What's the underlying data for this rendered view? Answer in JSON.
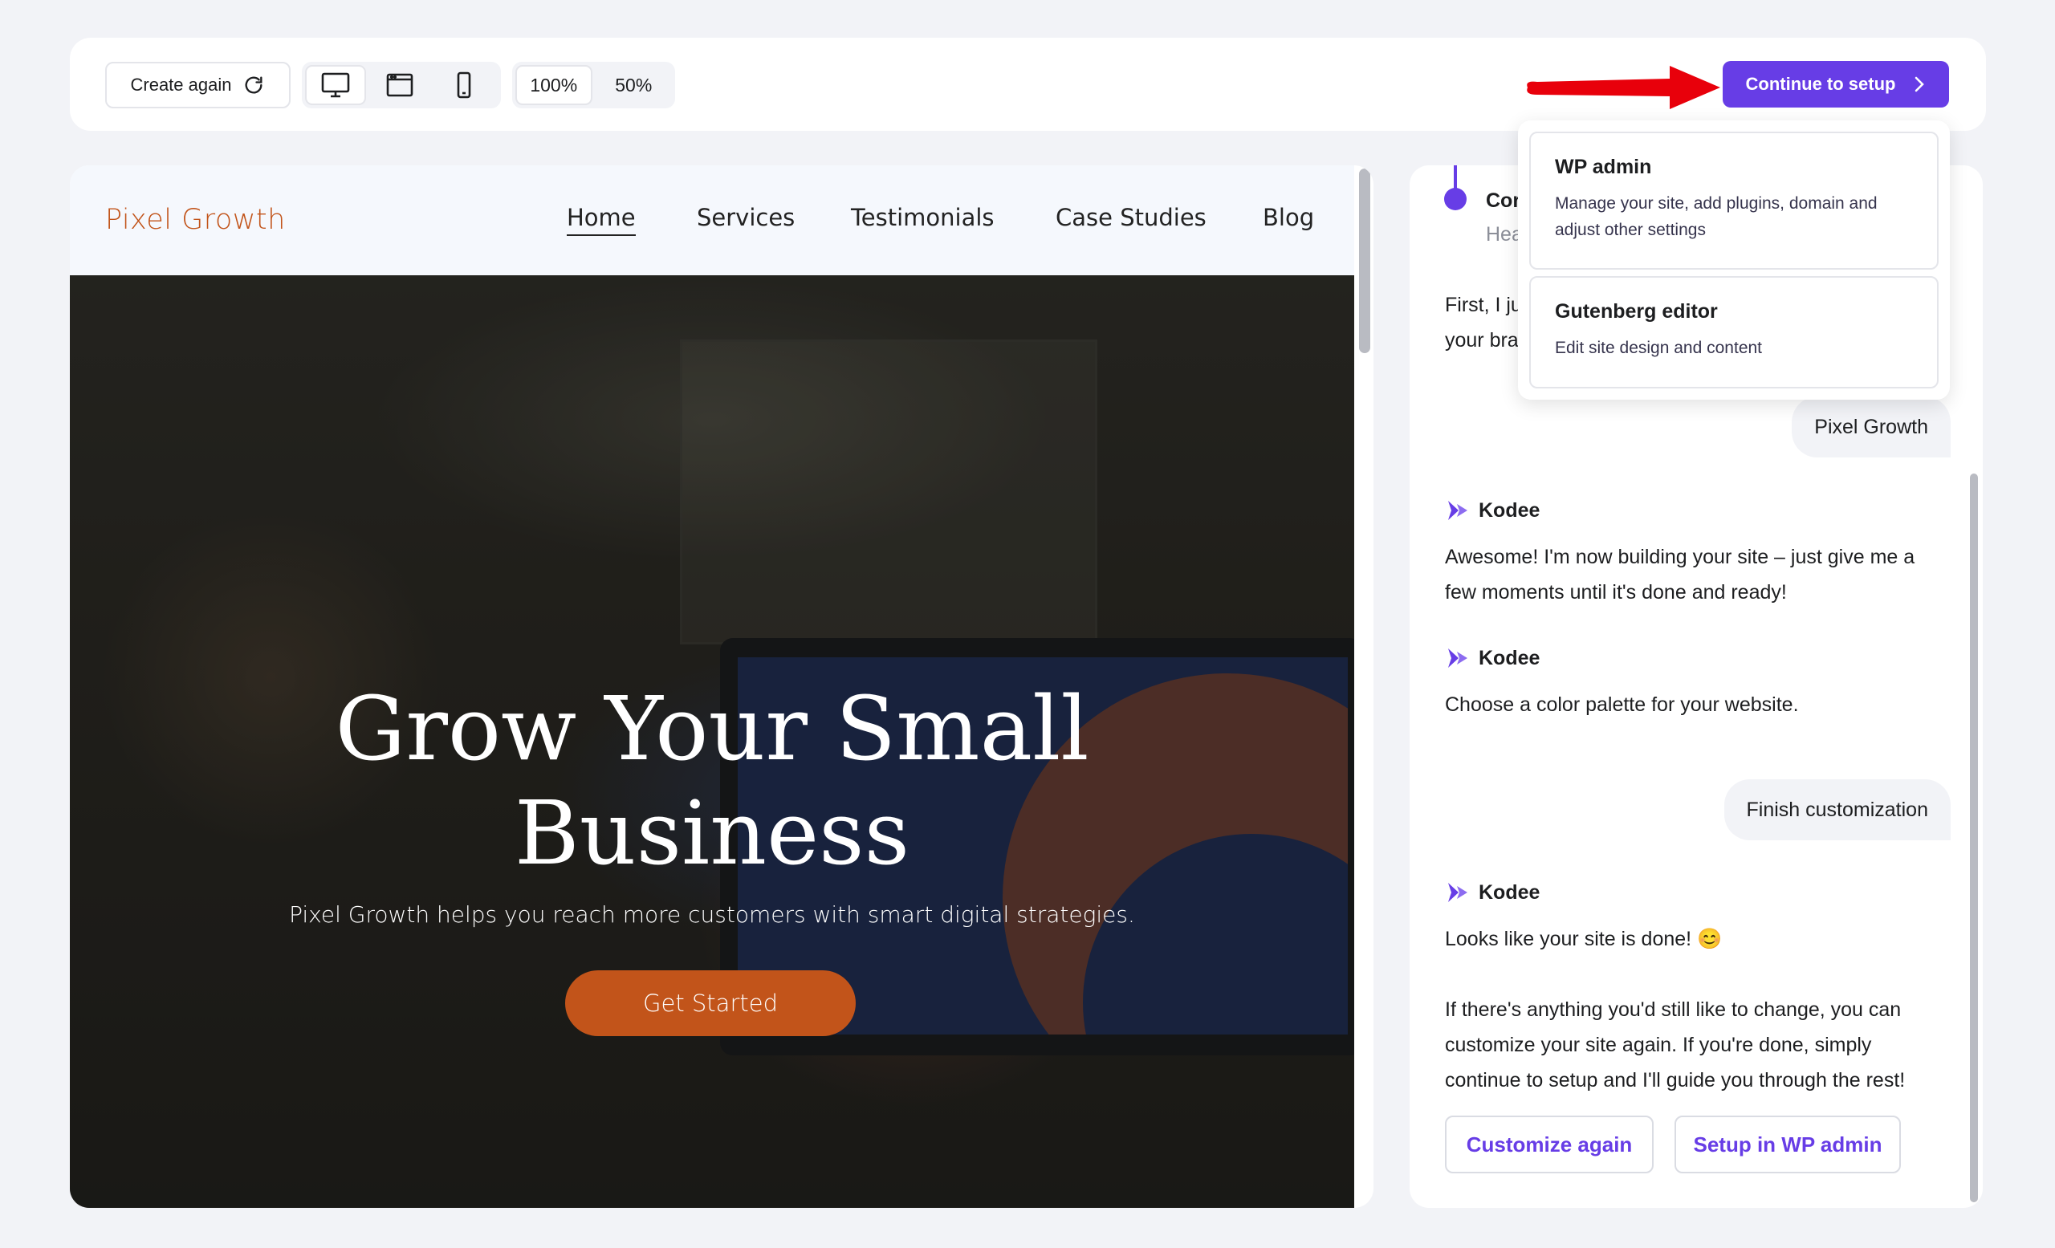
{
  "toolbar": {
    "create_again_label": "Create again",
    "zoom_options": [
      "100%",
      "50%"
    ],
    "continue_label": "Continue to setup"
  },
  "setup_menu": {
    "items": [
      {
        "title": "WP admin",
        "description": "Manage your site, add plugins, domain and adjust other settings"
      },
      {
        "title": "Gutenberg editor",
        "description": "Edit site design and content"
      }
    ]
  },
  "preview": {
    "logo": "Pixel Growth",
    "nav": [
      "Home",
      "Services",
      "Testimonials",
      "Case Studies",
      "Blog"
    ],
    "hero_title_line1": "Grow Your Small",
    "hero_title_line2": "Business",
    "hero_subtitle": "Pixel Growth helps you reach more customers with smart digital strategies.",
    "cta_label": "Get Started"
  },
  "chat": {
    "step_title": "Cor",
    "step_subtitle": "Hea",
    "intro_line1": "First, I ju",
    "intro_line2": "your bra",
    "user_msg_1": "Pixel Growth",
    "assistant_name": "Kodee",
    "msg_building_line1": "Awesome! I'm now building your site – just give me a",
    "msg_building_line2": "few moments until it's done and ready!",
    "msg_palette": "Choose a color palette for your website.",
    "user_msg_2": "Finish customization",
    "msg_done": "Looks like your site is done! 😊",
    "msg_final_line1": "If there's anything you'd still like to change, you can",
    "msg_final_line2": "customize your site again. If you're done, simply",
    "msg_final_line3": "continue to setup and I'll guide you through the rest!",
    "btn_customize": "Customize again",
    "btn_setup": "Setup in WP admin"
  },
  "colors": {
    "accent": "#673de6",
    "brand": "#c2541a",
    "arrow": "#e8000b"
  }
}
